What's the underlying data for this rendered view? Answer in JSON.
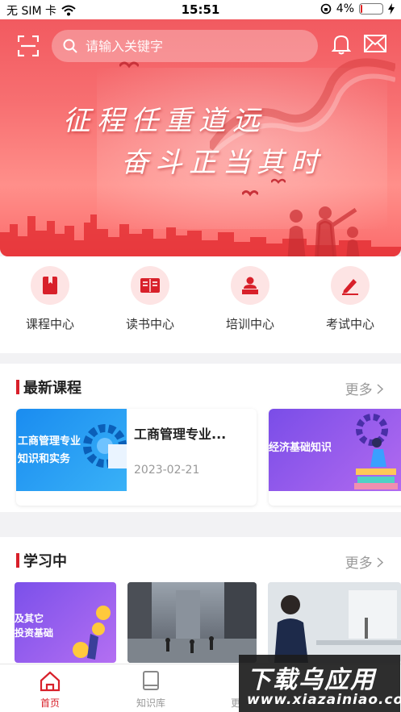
{
  "status_bar": {
    "carrier": "无 SIM 卡",
    "time": "15:51",
    "battery_percent": "4%",
    "battery_level": 0.04
  },
  "header": {
    "search_placeholder": "请输入关键字"
  },
  "banner": {
    "line1": "征程任重道远",
    "line2": "奋斗正当其时"
  },
  "quick_entries": [
    {
      "label": "课程中心",
      "icon": "book-icon"
    },
    {
      "label": "读书中心",
      "icon": "open-book-icon"
    },
    {
      "label": "培训中心",
      "icon": "lecturer-icon"
    },
    {
      "label": "考试中心",
      "icon": "pencil-icon"
    }
  ],
  "latest_courses": {
    "title": "最新课程",
    "more": "更多",
    "items": [
      {
        "thumb_text": "工商管理专业\n知识和实务",
        "title": "工商管理专业...",
        "date": "2023-02-21"
      },
      {
        "thumb_text": "经济基础知识"
      }
    ]
  },
  "learning": {
    "title": "学习中",
    "more": "更多",
    "items": [
      {
        "thumb_text": "及其它\n投资基础"
      },
      {
        "thumb_text": ""
      },
      {
        "thumb_text": ""
      }
    ]
  },
  "tabbar": {
    "tabs": [
      {
        "label": "首页",
        "active": true
      },
      {
        "label": "知识库",
        "active": false
      },
      {
        "label": "更",
        "active": false
      }
    ]
  },
  "watermark": {
    "line1": "下载乌应用",
    "line2": "www.xiazainiao.com"
  },
  "colors": {
    "accent": "#d8202a",
    "icon_bg": "#fde4e4"
  }
}
